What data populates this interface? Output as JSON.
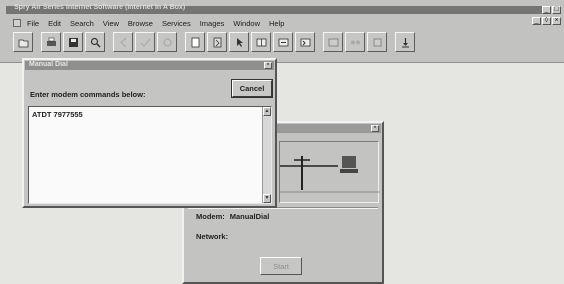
{
  "app": {
    "title": "Spry Air Series Internet Software (Internet In A Box)"
  },
  "menu": [
    "File",
    "Edit",
    "Search",
    "View",
    "Browse",
    "Services",
    "Images",
    "Window",
    "Help"
  ],
  "toolbar_icons": [
    "open-icon",
    "print-icon",
    "find-icon",
    "back-icon",
    "forward-icon",
    "reload-icon",
    "home-icon",
    "hotlist-icon",
    "bookmark-icon",
    "mail-icon",
    "news-icon",
    "gopher-icon",
    "ftp-icon",
    "telnet-icon",
    "stop-icon",
    "download-icon"
  ],
  "dialog": {
    "title": "Manual Dial",
    "prompt": "Enter modem commands below:",
    "cancel_label": "Cancel",
    "command_text": "ATDT 7977555"
  },
  "connection": {
    "modem_label": "Modem:",
    "modem_value": "ManualDial",
    "network_label": "Network:",
    "start_label": "Start"
  },
  "colors": {
    "desktop": "#e5e5e2",
    "window_face": "#c4c4c2",
    "titlebar_inactive": "#757575"
  }
}
